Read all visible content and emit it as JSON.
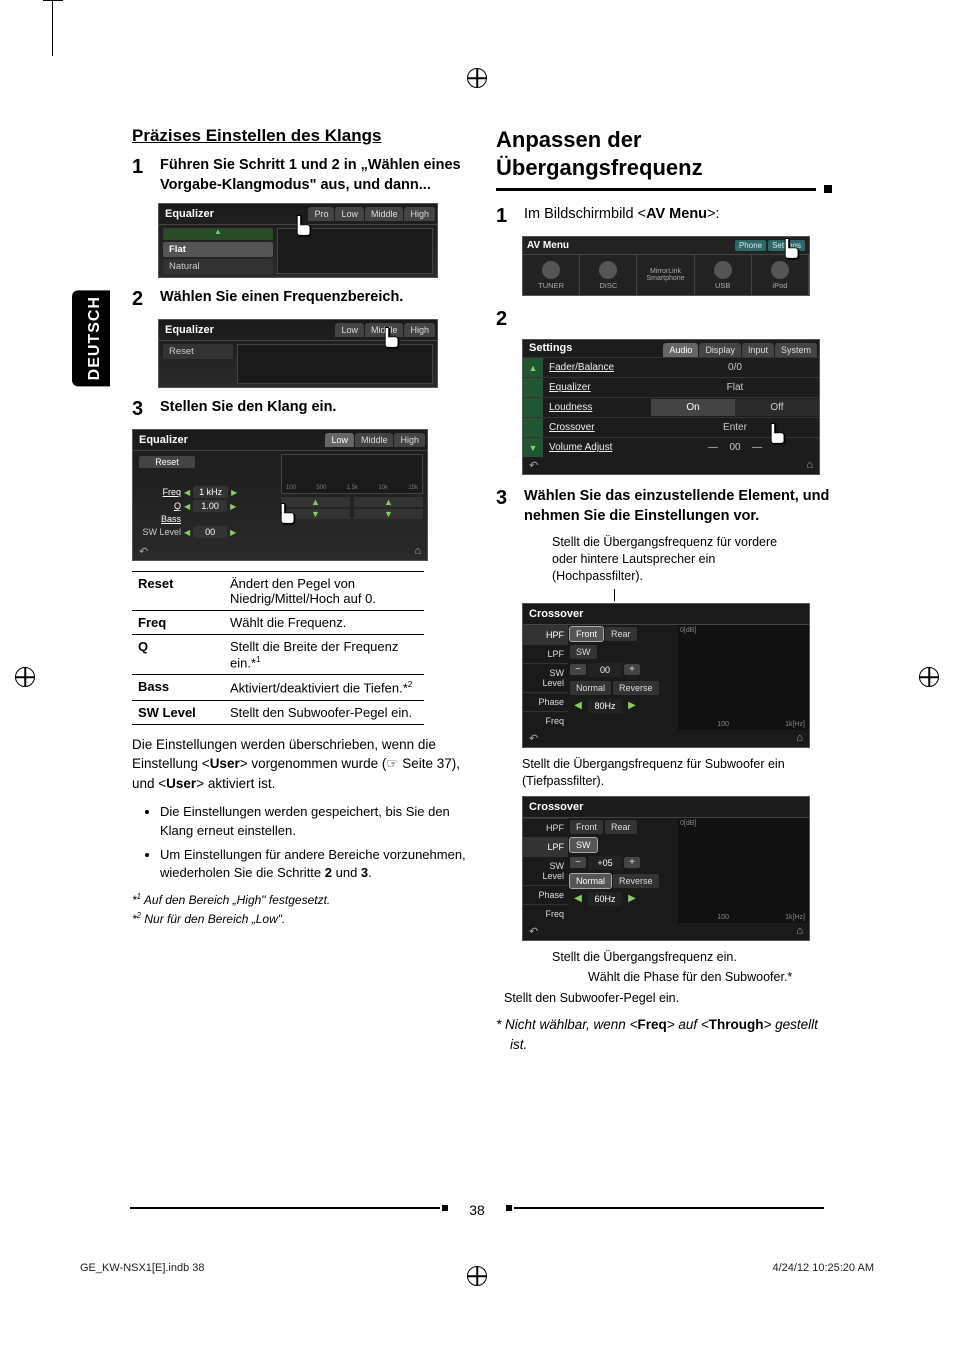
{
  "domain": "Document",
  "sideTab": "DEUTSCH",
  "left": {
    "heading": "Präzises Einstellen des Klangs",
    "step1": {
      "num": "1",
      "text_pre": "Führen Sie Schritt ",
      "b1": "1",
      "mid": " und ",
      "b2": "2",
      "text_post": " in „Wählen eines Vorgabe-Klangmodus\" aus, und dann..."
    },
    "ss1": {
      "title": "Equalizer",
      "tabs": [
        "Pro",
        "Low",
        "Middle",
        "High"
      ],
      "items_top": "▲",
      "items": [
        "Flat",
        "Natural"
      ]
    },
    "step2": {
      "num": "2",
      "text": "Wählen Sie einen Frequenzbereich."
    },
    "ss2": {
      "title": "Equalizer",
      "tabs": [
        "Low",
        "Middle",
        "High"
      ],
      "items": [
        "Reset"
      ]
    },
    "step3": {
      "num": "3",
      "text": "Stellen Sie den Klang ein."
    },
    "ss3": {
      "title": "Equalizer",
      "tabs": [
        "Low",
        "Middle",
        "High"
      ],
      "reset": "Reset",
      "rows": [
        {
          "lbl": "Freq",
          "val": "1 kHz"
        },
        {
          "lbl": "Q",
          "val": "1.00"
        },
        {
          "lbl": "Bass",
          "val": ""
        },
        {
          "lbl": "SW Level",
          "val": "00"
        }
      ],
      "xticks": [
        "100",
        "500",
        "1.5k",
        "10k",
        "15k"
      ]
    },
    "table": [
      {
        "k": "Reset",
        "v": "Ändert den Pegel von Niedrig/Mittel/Hoch auf 0."
      },
      {
        "k": "Freq",
        "v": "Wählt die Frequenz."
      },
      {
        "k": "Q",
        "v": "Stellt die Breite der Frequenz ein.*",
        "sup": "1"
      },
      {
        "k": "Bass",
        "v": "Aktiviert/deaktiviert die Tiefen.*",
        "sup": "2"
      },
      {
        "k": "SW Level",
        "v": "Stellt den Subwoofer-Pegel ein."
      }
    ],
    "para_pre": "Die Einstellungen werden überschrieben, wenn die Einstellung <",
    "para_b1": "User",
    "para_mid": "> vorgenommen wurde (☞ Seite 37), und <",
    "para_b2": "User",
    "para_post": "> aktiviert ist.",
    "bullets": [
      "Die Einstellungen werden gespeichert, bis Sie den Klang erneut einstellen.",
      {
        "pre": "Um Einstellungen für andere Bereiche vorzunehmen, wiederholen Sie die Schritte ",
        "b1": "2",
        "mid": " und ",
        "b2": "3",
        "post": "."
      }
    ],
    "footnotes": [
      {
        "mark": "*1",
        "text": "Auf den Bereich „High\" festgesetzt."
      },
      {
        "mark": "*2",
        "text": "Nur für den Bereich „Low\"."
      }
    ]
  },
  "right": {
    "heading": "Anpassen der Übergangsfrequenz",
    "step1": {
      "num": "1",
      "pre": "Im Bildschirmbild <",
      "b": "AV Menu",
      "post": ">:"
    },
    "avmenu": {
      "title": "AV Menu",
      "topbtns": [
        "Phone",
        "Settings"
      ],
      "cells": [
        "TUNER",
        "DISC",
        "MirrorLink Smartphone",
        "USB",
        "iPod"
      ]
    },
    "step2": {
      "num": "2"
    },
    "settings": {
      "title": "Settings",
      "tabs": [
        "Audio",
        "Display",
        "Input",
        "System"
      ],
      "rows": [
        {
          "label": "Fader/Balance",
          "val": "0/0"
        },
        {
          "label": "Equalizer",
          "val": "Flat"
        },
        {
          "label": "Loudness",
          "on": "On",
          "off": "Off"
        },
        {
          "label": "Crossover",
          "val": "Enter"
        },
        {
          "label": "Volume Adjust",
          "val": "00"
        }
      ]
    },
    "step3": {
      "num": "3",
      "text": "Wählen Sie das einzustellende Element, und nehmen Sie die Einstellungen vor."
    },
    "callout_hpf": "Stellt die Übergangsfrequenz für vordere oder hintere Lautsprecher ein (Hochpassfilter).",
    "xover1": {
      "title": "Crossover",
      "left": [
        "HPF",
        "LPF",
        "SW Level",
        "Phase",
        "Freq"
      ],
      "hpf_opts": [
        "Front",
        "Rear"
      ],
      "lpf_opt": "SW",
      "swlevel": "00",
      "phase": [
        "Normal",
        "Reverse"
      ],
      "freq": "80Hz",
      "ytop": "0[dB]",
      "xr": [
        "100",
        "1k[Hz]"
      ]
    },
    "caption_lpf": "Stellt die Übergangsfrequenz für Subwoofer ein (Tiefpassfilter).",
    "xover2": {
      "title": "Crossover",
      "left": [
        "HPF",
        "LPF",
        "SW Level",
        "Phase",
        "Freq"
      ],
      "hpf_opts": [
        "Front",
        "Rear"
      ],
      "lpf_opt": "SW",
      "swlevel": "+05",
      "phase": [
        "Normal",
        "Reverse"
      ],
      "freq": "60Hz",
      "ytop": "0[dB]",
      "xr": [
        "100",
        "1k[Hz]"
      ]
    },
    "callout_freq": "Stellt die Übergangsfrequenz ein.",
    "callout_phase": "Wählt die Phase für den Subwoofer.*",
    "callout_swlevel": "Stellt den Subwoofer-Pegel ein.",
    "footnote_pre": "* Nicht wählbar, wenn <",
    "footnote_b1": "Freq",
    "footnote_mid": "> auf <",
    "footnote_b2": "Through",
    "footnote_post": "> gestellt ist."
  },
  "pageNum": "38",
  "footerLeft": "GE_KW-NSX1[E].indb   38",
  "footerRight": "4/24/12   10:25:20 AM"
}
